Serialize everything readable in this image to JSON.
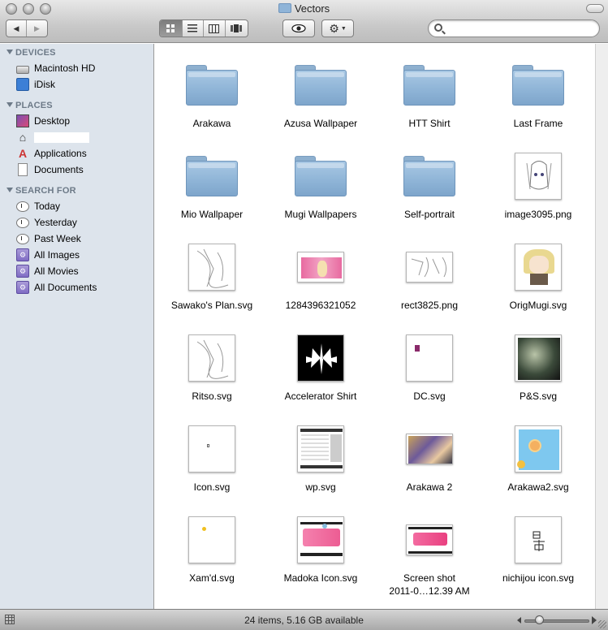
{
  "window": {
    "title": "Vectors"
  },
  "toolbar": {
    "back_icon": "◀",
    "forward_icon": "▶",
    "view_modes": [
      "icon-view",
      "list-view",
      "column-view",
      "cover-flow"
    ],
    "active_view": "icon-view",
    "quick_look_icon": "eye-icon",
    "action_icon": "gear-icon",
    "search": {
      "value": "",
      "placeholder": ""
    }
  },
  "sidebar": {
    "devices_header": "DEVICES",
    "devices": [
      {
        "label": "Macintosh HD",
        "icon": "hard-drive-icon"
      },
      {
        "label": "iDisk",
        "icon": "idisk-icon"
      }
    ],
    "places_header": "PLACES",
    "places": [
      {
        "label": "Desktop",
        "icon": "desktop-icon"
      },
      {
        "label": "",
        "icon": "home-icon"
      },
      {
        "label": "Applications",
        "icon": "applications-icon"
      },
      {
        "label": "Documents",
        "icon": "documents-icon"
      }
    ],
    "search_header": "SEARCH FOR",
    "searches": [
      {
        "label": "Today",
        "icon": "clock-icon"
      },
      {
        "label": "Yesterday",
        "icon": "clock-icon"
      },
      {
        "label": "Past Week",
        "icon": "clock-icon"
      },
      {
        "label": "All Images",
        "icon": "smart-folder-icon"
      },
      {
        "label": "All Movies",
        "icon": "smart-folder-icon"
      },
      {
        "label": "All Documents",
        "icon": "smart-folder-icon"
      }
    ]
  },
  "items": [
    {
      "label": "Arakawa",
      "kind": "folder"
    },
    {
      "label": "Azusa Wallpaper",
      "kind": "folder"
    },
    {
      "label": "HTT Shirt",
      "kind": "folder"
    },
    {
      "label": "Last Frame",
      "kind": "folder"
    },
    {
      "label": "Mio Wallpaper",
      "kind": "folder"
    },
    {
      "label": "Mugi Wallpapers",
      "kind": "folder"
    },
    {
      "label": "Self-portrait",
      "kind": "folder"
    },
    {
      "label": "image3095.png",
      "kind": "sketch-face"
    },
    {
      "label": "Sawako's Plan.svg",
      "kind": "sketch"
    },
    {
      "label": "1284396321052",
      "kind": "pink-wide"
    },
    {
      "label": "rect3825.png",
      "kind": "sketch-wide"
    },
    {
      "label": "OrigMugi.svg",
      "kind": "character"
    },
    {
      "label": "Ritso.svg",
      "kind": "sketch"
    },
    {
      "label": "Accelerator Shirt",
      "kind": "black-emblem"
    },
    {
      "label": "DC.svg",
      "kind": "blank-dot"
    },
    {
      "label": "P&S.svg",
      "kind": "dark-art"
    },
    {
      "label": "Icon.svg",
      "kind": "blank-small"
    },
    {
      "label": "wp.svg",
      "kind": "screen"
    },
    {
      "label": "Arakawa 2",
      "kind": "photo-wide"
    },
    {
      "label": "Arakawa2.svg",
      "kind": "blue-art"
    },
    {
      "label": "Xam'd.svg",
      "kind": "blank-yellow"
    },
    {
      "label": "Madoka Icon.svg",
      "kind": "madoka"
    },
    {
      "label": "Screen shot 2011-0…12.39 AM",
      "kind": "madoka-wide",
      "label_lines": [
        "Screen shot",
        "2011-0…12.39 AM"
      ]
    },
    {
      "label": "nichijou icon.svg",
      "kind": "kanji"
    }
  ],
  "status": {
    "text": "24 items, 5.16 GB available"
  },
  "colors": {
    "sidebar_bg": "#dde4ec",
    "folder_blue": "#8db3d6",
    "section_header": "#6d7a88"
  }
}
